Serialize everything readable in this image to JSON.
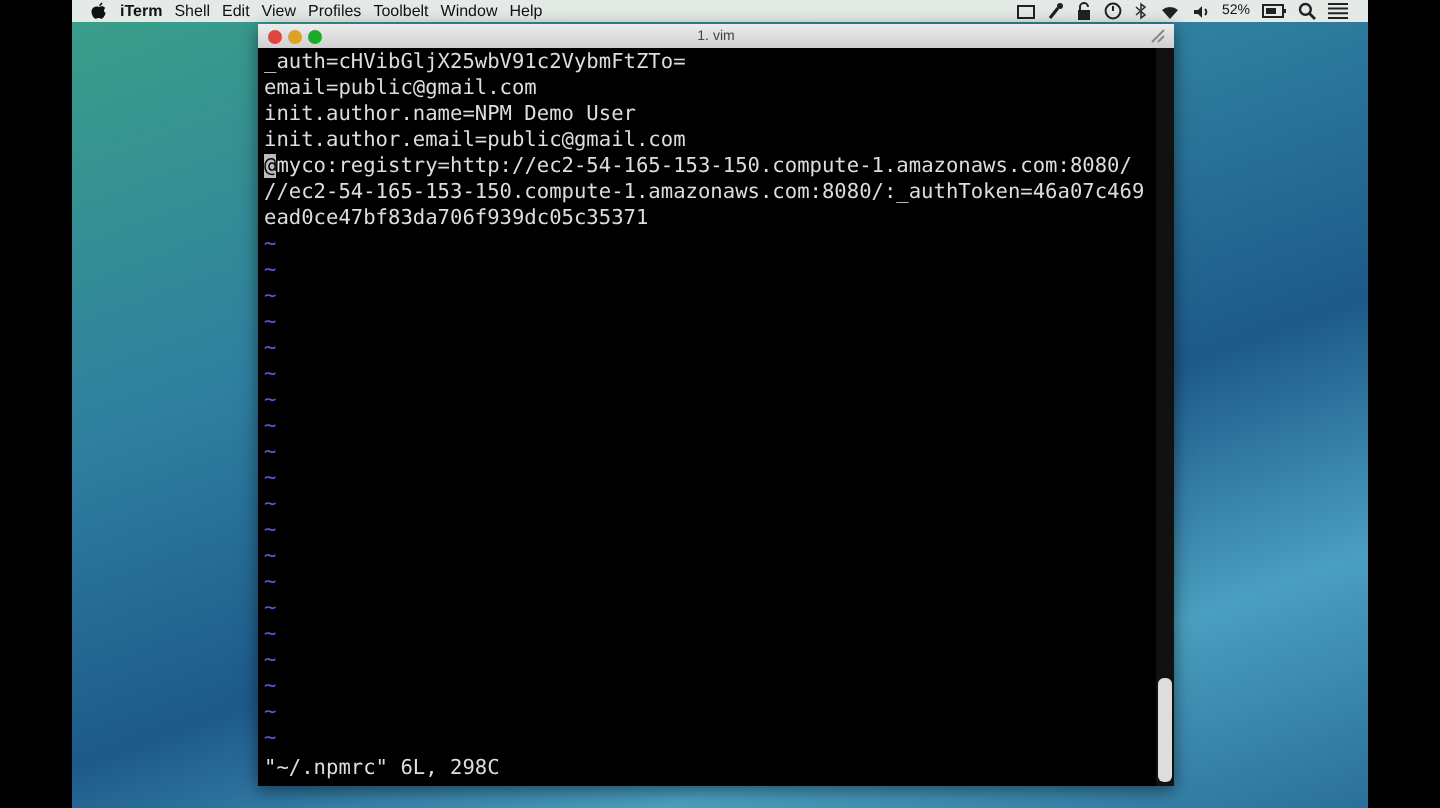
{
  "menu_bar": {
    "app": "iTerm",
    "items": [
      "Shell",
      "Edit",
      "View",
      "Profiles",
      "Toolbelt",
      "Window",
      "Help"
    ],
    "battery": "52%"
  },
  "window": {
    "title": "1. vim"
  },
  "lines": [
    {
      "text": "_auth=cHVibGljX25wbV91c2VybmFtZTo=",
      "cursor": false
    },
    {
      "text": "email=public@gmail.com",
      "cursor": false
    },
    {
      "text": "init.author.name=NPM Demo User",
      "cursor": false
    },
    {
      "text": "init.author.email=public@gmail.com",
      "cursor": false
    },
    {
      "text": "@myco:registry=http://ec2-54-165-153-150.compute-1.amazonaws.com:8080/",
      "cursor": true
    },
    {
      "text": "//ec2-54-165-153-150.compute-1.amazonaws.com:8080/:_authToken=46a07c469ead0ce47bf83da706f939dc05c35371",
      "cursor": false
    }
  ],
  "tildes": [
    "~",
    "~",
    "~",
    "~",
    "~",
    "~",
    "~",
    "~",
    "~",
    "~",
    "~",
    "~",
    "~",
    "~",
    "~",
    "~",
    "~",
    "~",
    "~",
    "~"
  ],
  "status_line": "\"~/.npmrc\" 6L, 298C"
}
